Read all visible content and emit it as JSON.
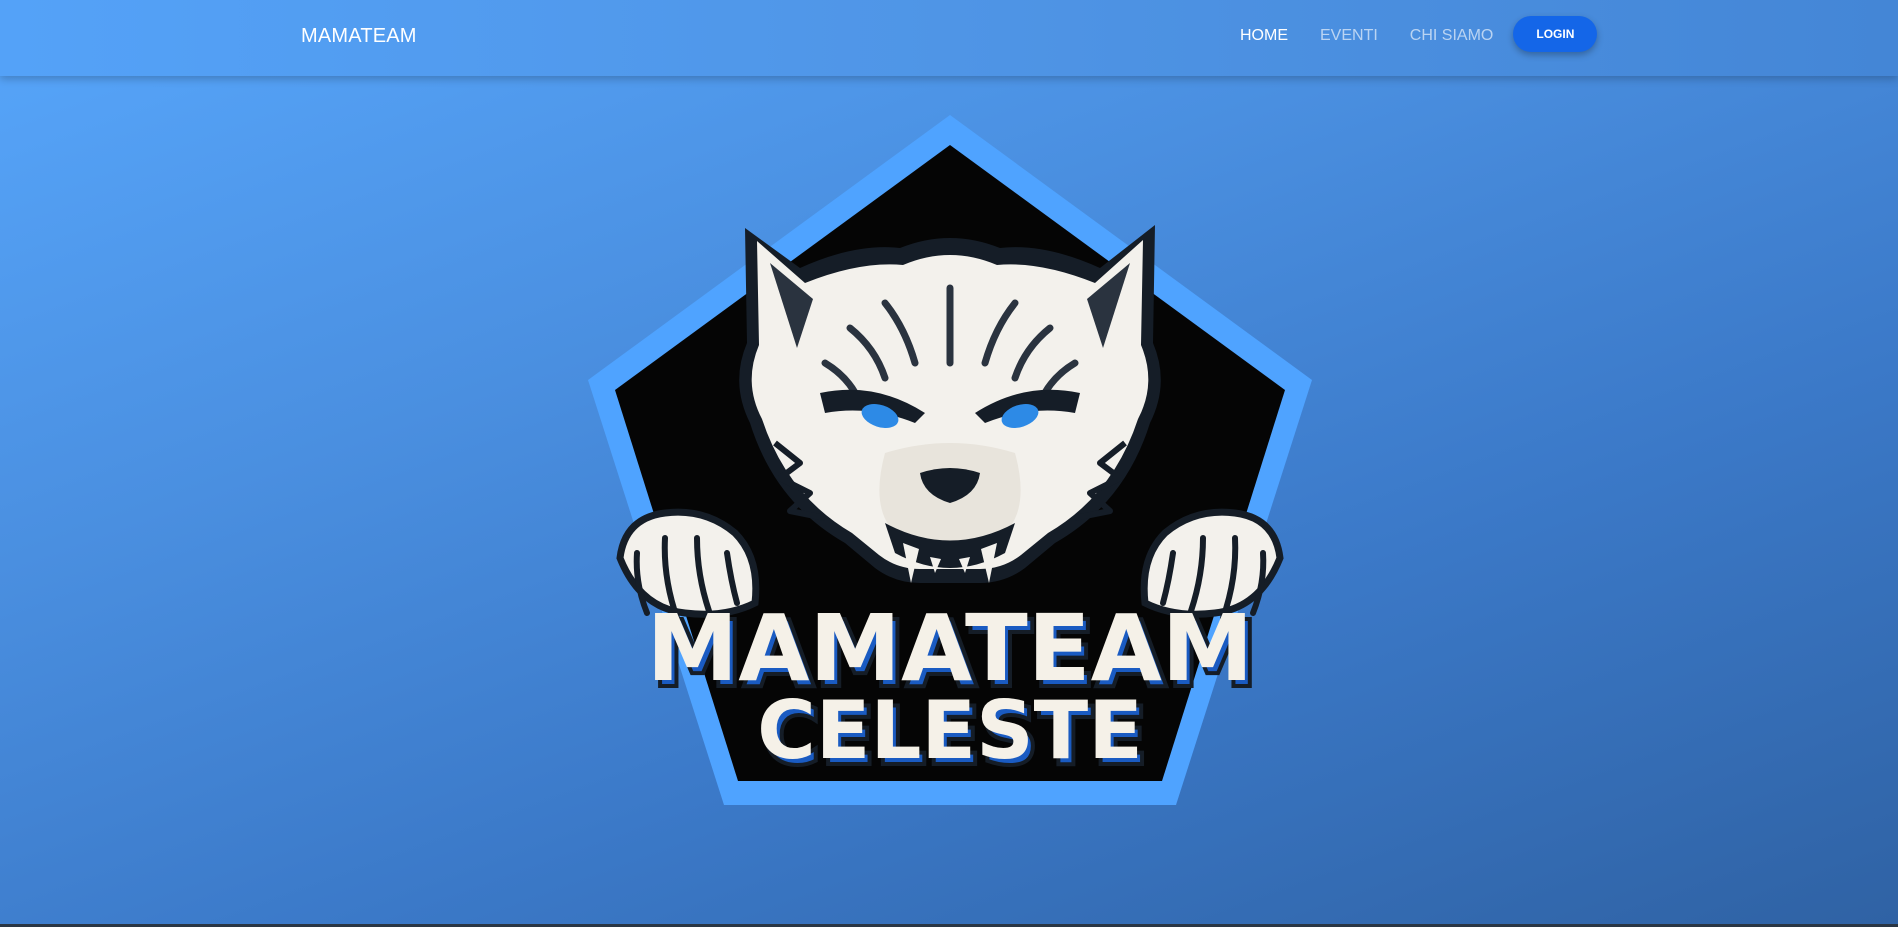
{
  "nav": {
    "brand": "MAMATEAM",
    "links": [
      {
        "label": "HOME",
        "active": true
      },
      {
        "label": "EVENTI",
        "active": false
      },
      {
        "label": "CHI SIAMO",
        "active": false
      }
    ],
    "login_label": "LOGIN"
  },
  "hero": {
    "logo": {
      "icon": "wolf-emblem",
      "line1": "MAMATEAM",
      "line2": "CELESTE"
    }
  },
  "colors": {
    "background_start": "#57a6fb",
    "background_end": "#2f62a4",
    "login_button": "#1466e8",
    "emblem_border": "#4fa3ff",
    "emblem_fill": "#050505",
    "emblem_text": "#f5f1e8",
    "emblem_text_shadow": "#1a5bc2"
  }
}
